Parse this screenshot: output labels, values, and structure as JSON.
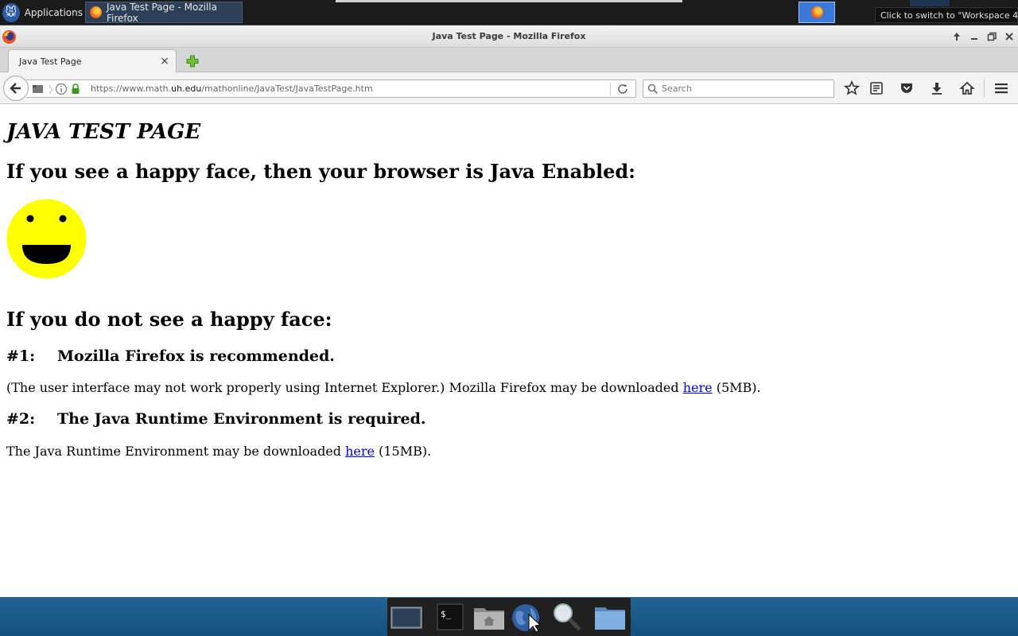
{
  "desktop": {
    "apps_menu_label": "Applications",
    "taskbar_window_title": "Java Test Page - Mozilla Firefox",
    "workspace_tooltip": "Click to switch to \"Workspace 4\""
  },
  "window": {
    "title": "Java Test Page - Mozilla Firefox"
  },
  "tabs": [
    {
      "label": "Java Test Page",
      "active": true
    }
  ],
  "navbar": {
    "url_prefix": "https://www.math.",
    "url_domain": "uh.edu",
    "url_path": "/mathonline/JavaTest/JavaTestPage.htm",
    "search_placeholder": "Search"
  },
  "page": {
    "heading": "JAVA TEST PAGE",
    "headline_enabled": "If you see a happy face, then your browser is Java Enabled:",
    "headline_not": "If you do not see a happy face:",
    "steps": [
      {
        "number": "#1:",
        "title": "Mozilla Firefox is recommended.",
        "text_before": "(The user interface may not work properly using Internet Explorer.) Mozilla Firefox may be downloaded ",
        "link": "here",
        "text_after": " (5MB)."
      },
      {
        "number": "#2:",
        "title": "The Java Runtime Environment is required.",
        "text_before": "The Java Runtime Environment may be downloaded ",
        "link": "here",
        "text_after": " (15MB)."
      }
    ]
  },
  "colors": {
    "smiley_face": "#ffff00",
    "link": "#0000ee",
    "dock_background": "#1b5a8a"
  }
}
